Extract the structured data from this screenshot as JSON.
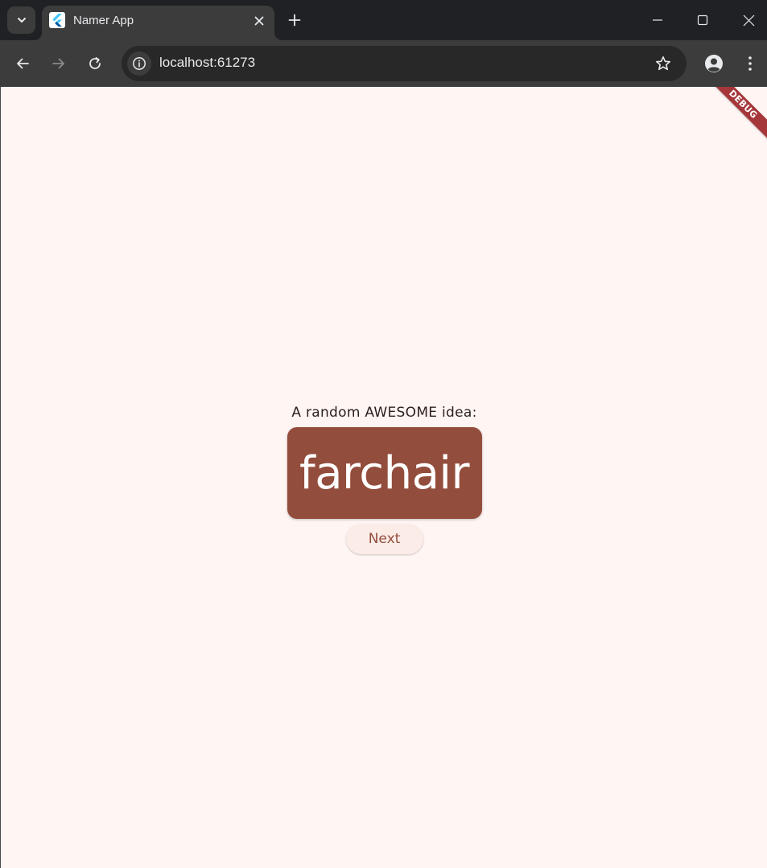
{
  "browser": {
    "tab": {
      "title": "Namer App",
      "favicon": "flutter-logo-icon"
    },
    "address_bar": {
      "url": "localhost:61273"
    },
    "icons": {
      "tab_search": "chevron-down-icon",
      "tab_close": "close-icon",
      "new_tab": "plus-icon",
      "minimize": "minimize-icon",
      "maximize": "maximize-icon",
      "close_window": "close-window-icon",
      "back": "arrow-left-icon",
      "forward": "arrow-right-icon",
      "reload": "reload-icon",
      "site_info": "info-icon",
      "bookmark": "star-icon",
      "profile": "profile-icon",
      "menu": "kebab-menu-icon"
    }
  },
  "app": {
    "debug_banner": "DEBUG",
    "label": "A random AWESOME idea:",
    "word": "farchair",
    "next_button": "Next",
    "colors": {
      "background": "#fff6f4",
      "card": "#934d3c",
      "card_text": "#ffffff",
      "button_bg": "#fcece8",
      "button_text": "#934d3c",
      "debug_banner": "#a5363a"
    }
  }
}
